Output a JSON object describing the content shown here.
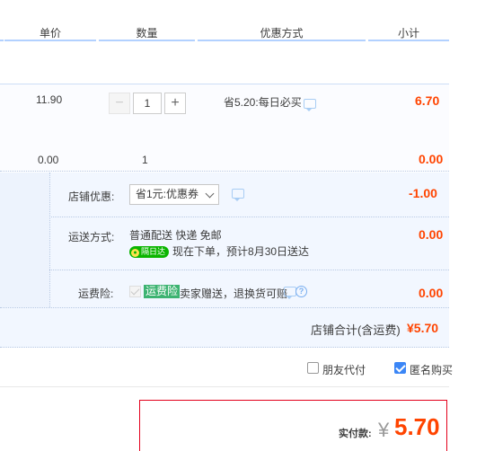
{
  "header": {
    "unit_price": "单价",
    "quantity": "数量",
    "discount_method": "优惠方式",
    "subtotal": "小计"
  },
  "item1": {
    "price": "11.90",
    "quantity": "1",
    "minus": "−",
    "plus": "+",
    "promo": "省5.20:每日必买",
    "subtotal": "6.70"
  },
  "item2": {
    "price": "0.00",
    "quantity": "1",
    "subtotal": "0.00"
  },
  "shop": {
    "coupon_label": "店铺优惠:",
    "coupon_value": "省1元:优惠券",
    "coupon_discount": "-1.00",
    "shipping_label": "运送方式:",
    "shipping_line1": "普通配送 快递 免邮",
    "shipping_badge": "隔日达",
    "shipping_line2": "现在下单，预计8月30日送达",
    "shipping_fee": "0.00",
    "insurance_label": "运费险:",
    "insurance_badge": "运费险",
    "insurance_text": "卖家赠送，退换货可赔",
    "insurance_help": "?",
    "insurance_fee": "0.00",
    "total_label": "店铺合计(含运费)",
    "total_value": "¥5.70"
  },
  "options": {
    "friend_pay": "朋友代付",
    "friend_pay_checked": false,
    "anonymous": "匿名购买",
    "anonymous_checked": true
  },
  "payment": {
    "label": "实付款:",
    "currency": "¥",
    "amount": "5.70"
  },
  "colors": {
    "accent_red": "#ff4400",
    "header_line": "#b2d1ff",
    "checkbox_blue": "#3b86f6",
    "badge_green": "#0bb500",
    "insurance_green": "#3cb371"
  },
  "icons": [
    "message-icon",
    "question-icon",
    "chevron-down-icon",
    "check-icon"
  ]
}
